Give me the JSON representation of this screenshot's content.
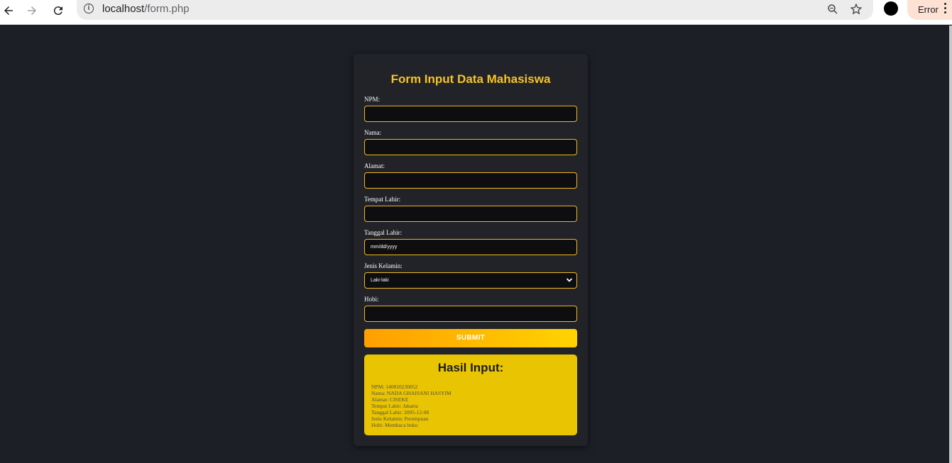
{
  "browser": {
    "url_host": "localhost",
    "url_path": "/form.php",
    "error_label": "Error"
  },
  "form": {
    "title": "Form Input Data Mahasiswa",
    "fields": [
      {
        "label": "NPM:",
        "value": ""
      },
      {
        "label": "Nama:",
        "value": ""
      },
      {
        "label": "Alamat:",
        "value": ""
      },
      {
        "label": "Tempat Lahir:",
        "value": ""
      },
      {
        "label": "Tanggal Lahir:",
        "value": "mm/dd/yyyy"
      },
      {
        "label": "Jenis Kelamin:",
        "value": "Laki-laki"
      },
      {
        "label": "Hobi:",
        "value": ""
      }
    ],
    "submit_label": "SUBMIT"
  },
  "result": {
    "title": "Hasil Input:",
    "lines": [
      "NPM: 140810230052",
      "Nama: NADA GHAISANI HASYIM",
      "Alamat: CISEKE",
      "Tempat Lahir: Jakarta",
      "Tanggal Lahir: 2005-12-08",
      "Jenis Kelamin: Perempuan",
      "Hobi: Membaca buku"
    ]
  },
  "colors": {
    "page_bg": "#1c1f26",
    "card_bg": "#212328",
    "accent": "#f7c325",
    "result_bg": "#e8c402"
  }
}
